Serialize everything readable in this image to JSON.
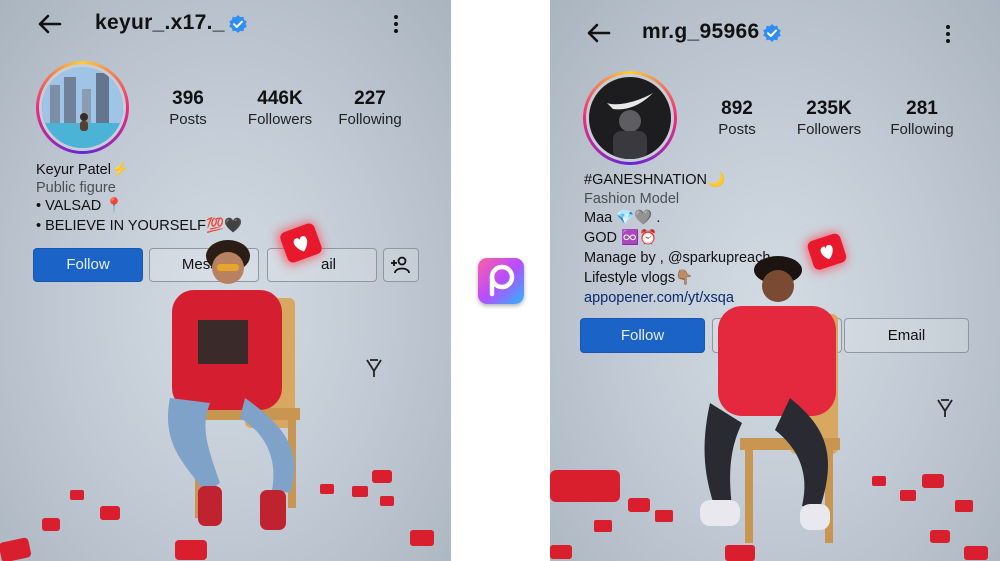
{
  "left": {
    "username": "keyur_.x17._",
    "stats": [
      {
        "value": "396",
        "label": "Posts"
      },
      {
        "value": "446K",
        "label": "Followers"
      },
      {
        "value": "227",
        "label": "Following"
      }
    ],
    "bio": [
      "Keyur Patel⚡",
      "Public figure",
      "• VALSAD 📍",
      "• BELIEVE IN YOURSELF💯🖤"
    ],
    "buttons": {
      "follow": "Follow",
      "message": "Messa",
      "email": "ail"
    }
  },
  "right": {
    "username": "mr.g_95966",
    "stats": [
      {
        "value": "892",
        "label": "Posts"
      },
      {
        "value": "235K",
        "label": "Followers"
      },
      {
        "value": "281",
        "label": "Following"
      }
    ],
    "bio": [
      "#GANESHNATION🌙",
      "Fashion Model",
      "Maa 💎🩶 .",
      "GOD ♾️⏰",
      "Manage by , @sparkupreach",
      "Lifestyle vlogs👇🏽",
      "appopener.com/yt/xsqa"
    ],
    "buttons": {
      "follow": "Follow",
      "email": "Email"
    }
  },
  "colors": {
    "accent": "#1b63c6",
    "verified": "#2f8df5",
    "heart": "#e8192c"
  },
  "icons": [
    "back-arrow-icon",
    "verified-badge-icon",
    "more-options-icon",
    "add-person-icon",
    "heart-notification-icon",
    "picsart-app-icon"
  ]
}
